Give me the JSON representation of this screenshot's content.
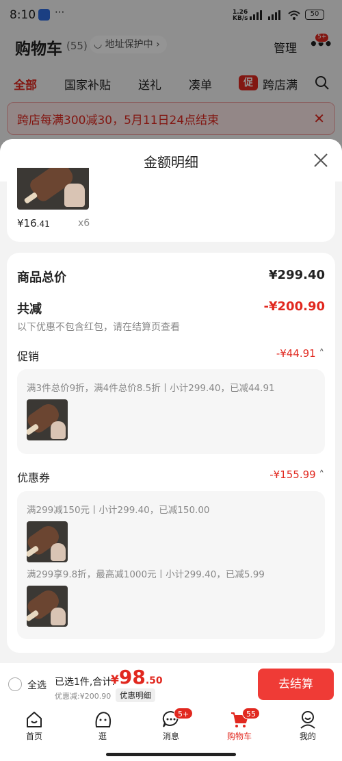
{
  "status": {
    "time": "8:10",
    "net_speed": "1.26",
    "net_unit": "KB/s",
    "battery": "50",
    "more": "···"
  },
  "header": {
    "title": "购物车",
    "count": "(55)",
    "address": "地址保护中",
    "manage": "管理",
    "more_badge": "5+"
  },
  "tabs": [
    {
      "label": "全部",
      "active": true
    },
    {
      "label": "国家补贴"
    },
    {
      "label": "送礼"
    },
    {
      "label": "凑单"
    },
    {
      "label": "跨店满",
      "tag": "促"
    }
  ],
  "promo_banner": "跨店每满300减30，5月11日24点结束",
  "sheet": {
    "title": "金额明细",
    "top_item": {
      "price_symbol": "¥",
      "price_int": "16",
      "price_dec": ".41",
      "qty": "x6"
    },
    "total_label": "商品总价",
    "total_value": "¥299.40",
    "discount_label": "共减",
    "discount_value": "-¥200.90",
    "discount_note": "以下优惠不包含红包，请在结算页查看",
    "promo_section": {
      "label": "促销",
      "value": "-¥44.91",
      "rule": "满3件总价9折，满4件总价8.5折丨小计299.40，已减44.91"
    },
    "coupon_section": {
      "label": "优惠券",
      "value": "-¥155.99",
      "rules": [
        "满299减150元丨小计299.40，已减150.00",
        "满299享9.8折，最高减1000元丨小计299.40，已减5.99"
      ]
    }
  },
  "checkout": {
    "select_all": "全选",
    "selected": "已选1件,合计:",
    "currency": "¥",
    "total_int": "98",
    "total_dec": ".50",
    "saved": "优惠减:¥200.90",
    "detail_btn": "优惠明细",
    "pay_btn": "去结算"
  },
  "nav": [
    {
      "label": "首页",
      "icon": "home-icon"
    },
    {
      "label": "逛",
      "icon": "browse-icon"
    },
    {
      "label": "消息",
      "icon": "message-icon",
      "badge": "5+"
    },
    {
      "label": "购物车",
      "icon": "cart-icon",
      "badge": "55",
      "active": true
    },
    {
      "label": "我的",
      "icon": "profile-icon"
    }
  ],
  "colors": {
    "accent": "#e1281f",
    "button": "#ef3b36"
  }
}
